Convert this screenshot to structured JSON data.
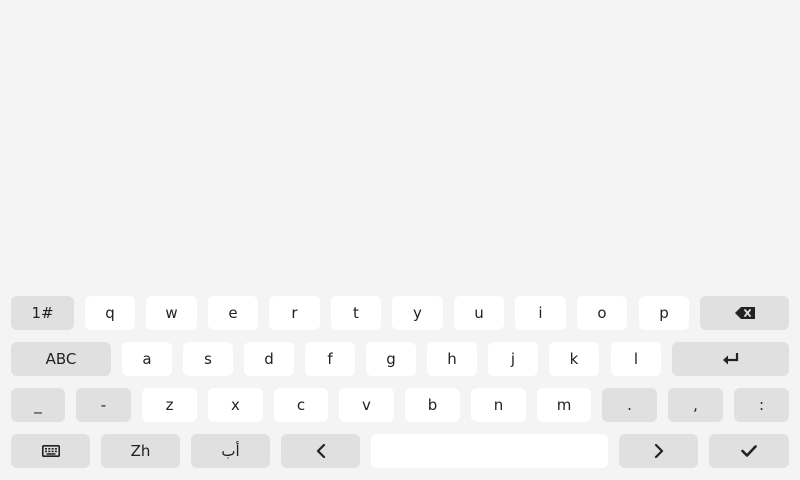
{
  "keyboard": {
    "row1": {
      "mode_symbols": "1#",
      "letters": [
        "q",
        "w",
        "e",
        "r",
        "t",
        "y",
        "u",
        "i",
        "o",
        "p"
      ],
      "backspace_icon": "backspace-icon"
    },
    "row2": {
      "mode_abc": "ABC",
      "letters": [
        "a",
        "s",
        "d",
        "f",
        "g",
        "h",
        "j",
        "k",
        "l"
      ],
      "enter_icon": "enter-icon"
    },
    "row3": {
      "symbols_left": [
        "_",
        "-"
      ],
      "letters": [
        "z",
        "x",
        "c",
        "v",
        "b",
        "n",
        "m"
      ],
      "symbols_right": [
        ".",
        ",",
        ":"
      ]
    },
    "row4": {
      "keyboard_icon": "keyboard-icon",
      "lang_zh": "Zh",
      "lang_arabic": "أب",
      "left_icon": "chevron-left-icon",
      "space": "",
      "right_icon": "chevron-right-icon",
      "done_icon": "check-icon"
    },
    "colors": {
      "background": "#f4f4f4",
      "key_light": "#ffffff",
      "key_dark": "#e0e0e0",
      "text": "#222222"
    }
  }
}
